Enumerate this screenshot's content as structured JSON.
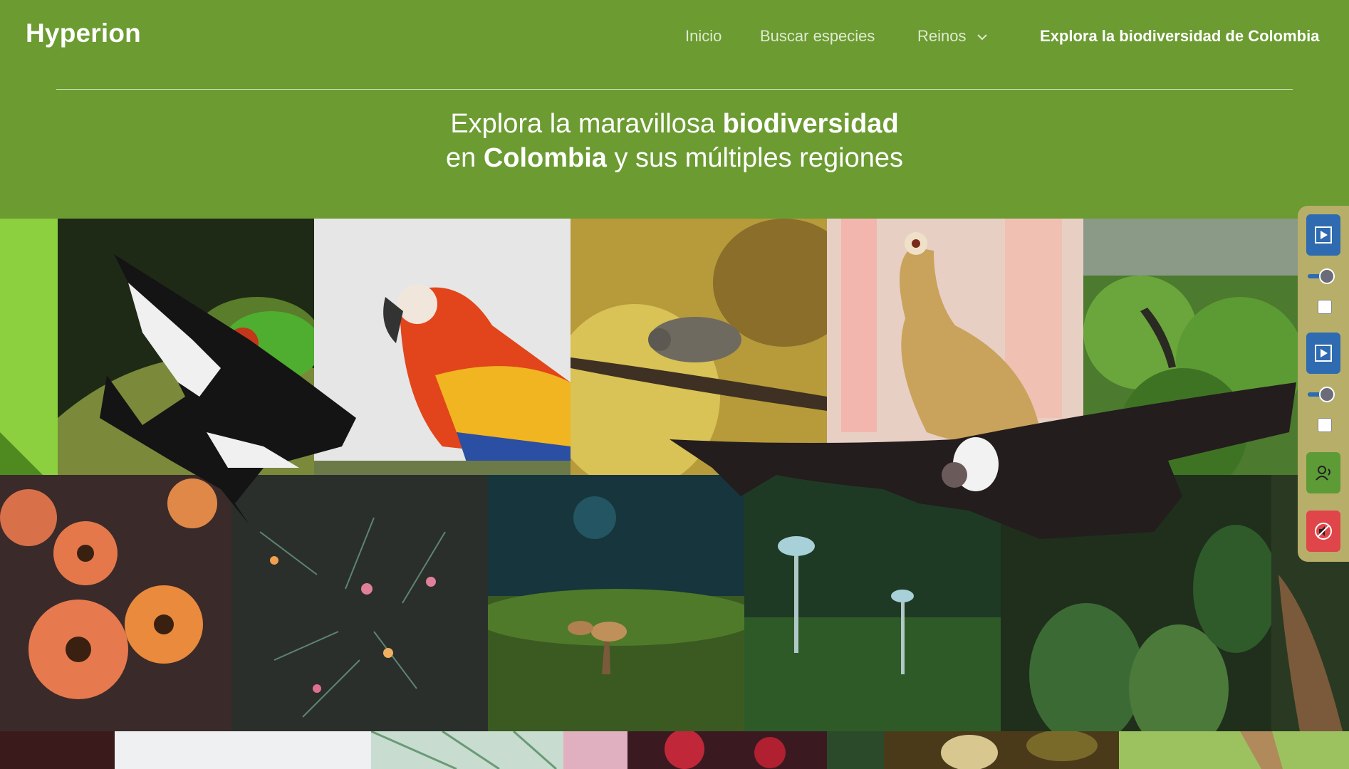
{
  "header": {
    "logo": "Hyperion",
    "nav": {
      "inicio": "Inicio",
      "buscar": "Buscar especies",
      "reinos": "Reinos",
      "explora": "Explora la biodiversidad de Colombia"
    },
    "hero": {
      "line1_pre": "Explora la maravillosa ",
      "line1_bold": "biodiversidad",
      "line2_pre": "en ",
      "line2_bold": "Colombia",
      "line2_post": " y sus múltiples regiones"
    }
  },
  "colors": {
    "header_bg": "#6b9b31",
    "panel_bg": "#b7ae6a",
    "panel_blue": "#2e6bb0",
    "panel_green": "#5c9b36",
    "panel_red": "#e0454a"
  },
  "gallery": {
    "tiles": [
      "leaf-green",
      "red-eyed-tree-frog",
      "scarlet-macaw",
      "grey-bird-on-branch",
      "egyptian-goose-flamingos",
      "lizard-in-shrub",
      "orange-daisies",
      "spiky-plant-flowers",
      "mushrooms-moss",
      "pale-mushrooms",
      "tropical-leaves",
      "tree-bark",
      "dark-strip",
      "white-sky",
      "caladium-leaves",
      "red-flowers",
      "dry-leaves",
      "deer-grass"
    ],
    "overlays": [
      "andean-condor-left",
      "andean-condor-right"
    ]
  },
  "sidepanel": {
    "buttons": [
      "play-icon",
      "play-icon",
      "reader-icon",
      "mute-icon"
    ]
  }
}
